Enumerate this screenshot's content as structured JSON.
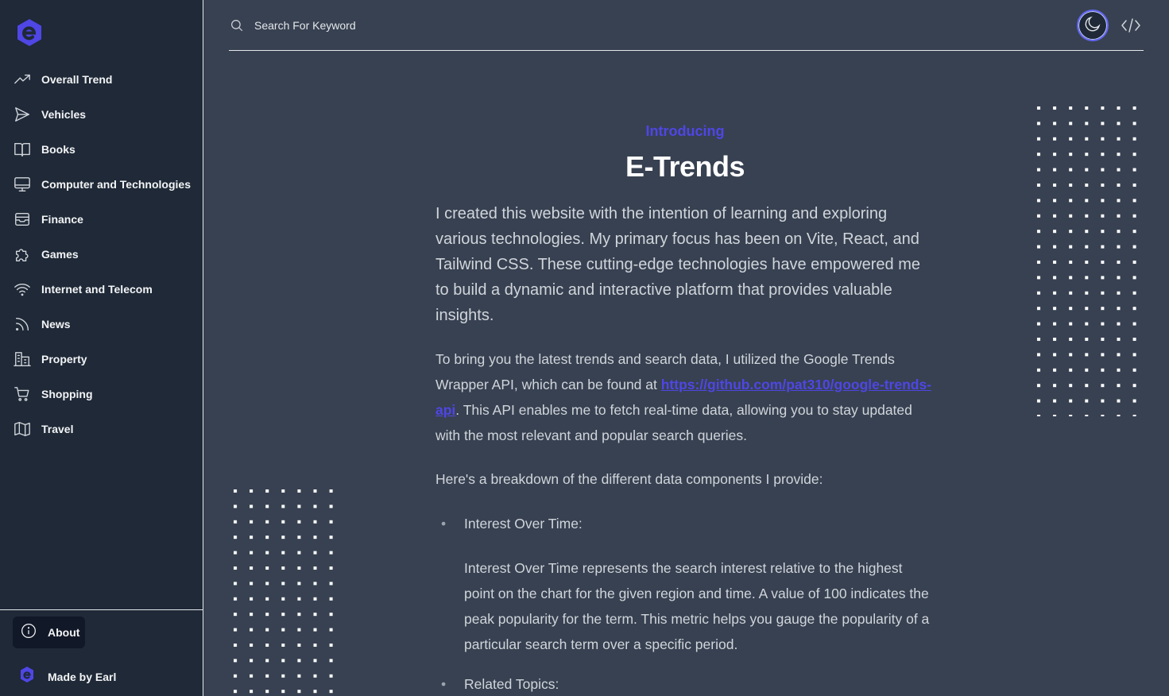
{
  "sidebar": {
    "items": [
      {
        "label": "Overall Trend",
        "icon": "trending-up-icon"
      },
      {
        "label": "Vehicles",
        "icon": "send-icon"
      },
      {
        "label": "Books",
        "icon": "book-open-icon"
      },
      {
        "label": "Computer and Technologies",
        "icon": "monitor-icon"
      },
      {
        "label": "Finance",
        "icon": "archive-icon"
      },
      {
        "label": "Games",
        "icon": "puzzle-icon"
      },
      {
        "label": "Internet and Telecom",
        "icon": "wifi-icon"
      },
      {
        "label": "News",
        "icon": "rss-icon"
      },
      {
        "label": "Property",
        "icon": "building-icon"
      },
      {
        "label": "Shopping",
        "icon": "shopping-cart-icon"
      },
      {
        "label": "Travel",
        "icon": "map-icon"
      }
    ],
    "about_label": "About",
    "made_by_label": "Made by Earl"
  },
  "header": {
    "search_placeholder": "Search For Keyword"
  },
  "main": {
    "intro": "Introducing",
    "title": "E-Trends",
    "lead": "I created this website with the intention of learning and exploring various technologies. My primary focus has been on Vite, React, and Tailwind CSS. These cutting-edge technologies have empowered me to build a dynamic and interactive platform that provides valuable insights.",
    "para1_before": "To bring you the latest trends and search data, I utilized the Google Trends Wrapper API, which can be found at ",
    "para1_link": "https://github.com/pat310/google-trends-api",
    "para1_after": ". This API enables me to fetch real-time data, allowing you to stay updated with the most relevant and popular search queries.",
    "para2": "Here's a breakdown of the different data components I provide:",
    "components": [
      {
        "name": "Interest Over Time:",
        "description": "Interest Over Time represents the search interest relative to the highest point on the chart for the given region and time. A value of 100 indicates the peak popularity for the term. This metric helps you gauge the popularity of a particular search term over a specific period."
      },
      {
        "name": "Related Topics:"
      }
    ]
  },
  "colors": {
    "accent": "#4f46e5",
    "sidebar_bg": "#1f2937",
    "main_bg": "#374151"
  }
}
